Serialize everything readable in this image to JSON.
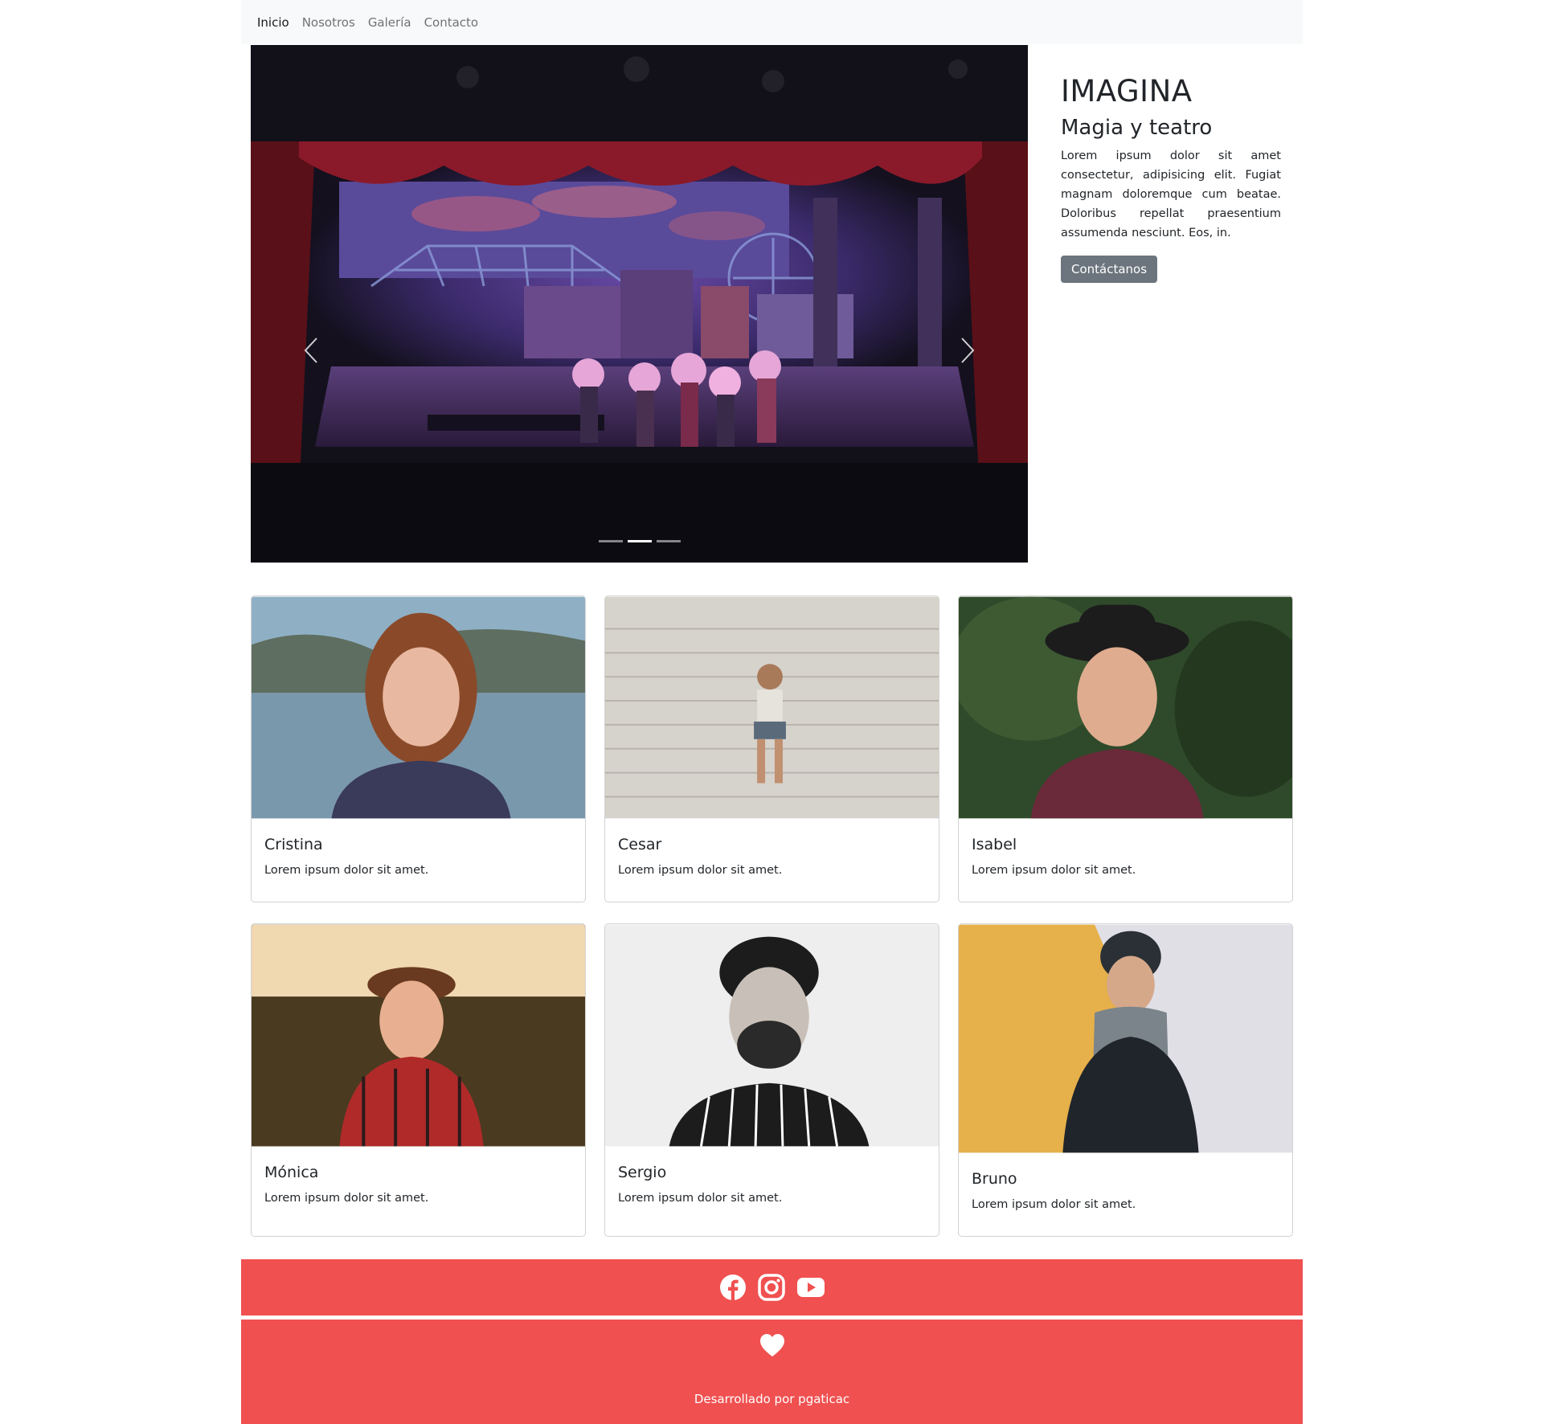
{
  "nav": {
    "items": [
      {
        "label": "Inicio",
        "active": true
      },
      {
        "label": "Nosotros",
        "active": false
      },
      {
        "label": "Galería",
        "active": false
      },
      {
        "label": "Contacto",
        "active": false
      }
    ]
  },
  "carousel": {
    "slide_count": 3,
    "active_index": 1,
    "prev_icon": "chevron-left-icon",
    "next_icon": "chevron-right-icon"
  },
  "hero": {
    "title": "IMAGINA",
    "subtitle": "Magia y teatro",
    "text": "Lorem ipsum dolor sit amet consectetur, adipisicing elit. Fugiat magnam doloremque cum beatae. Doloribus repellat praesentium assumenda nesciunt. Eos, in.",
    "button_label": "Contáctanos"
  },
  "cards": [
    {
      "name": "Cristina",
      "text": "Lorem ipsum dolor sit amet."
    },
    {
      "name": "Cesar",
      "text": "Lorem ipsum dolor sit amet."
    },
    {
      "name": "Isabel",
      "text": "Lorem ipsum dolor sit amet."
    },
    {
      "name": "Mónica",
      "text": "Lorem ipsum dolor sit amet."
    },
    {
      "name": "Sergio",
      "text": "Lorem ipsum dolor sit amet."
    },
    {
      "name": "Bruno",
      "text": "Lorem ipsum dolor sit amet."
    }
  ],
  "social": {
    "icons": [
      "facebook-icon",
      "instagram-icon",
      "youtube-icon"
    ]
  },
  "footer": {
    "icon": "heart-icon",
    "credit": "Desarrollado por pgaticac"
  },
  "colors": {
    "footer_bg": "#f05050",
    "navbar_bg": "#f8f9fa",
    "button_bg": "#6c757d"
  }
}
